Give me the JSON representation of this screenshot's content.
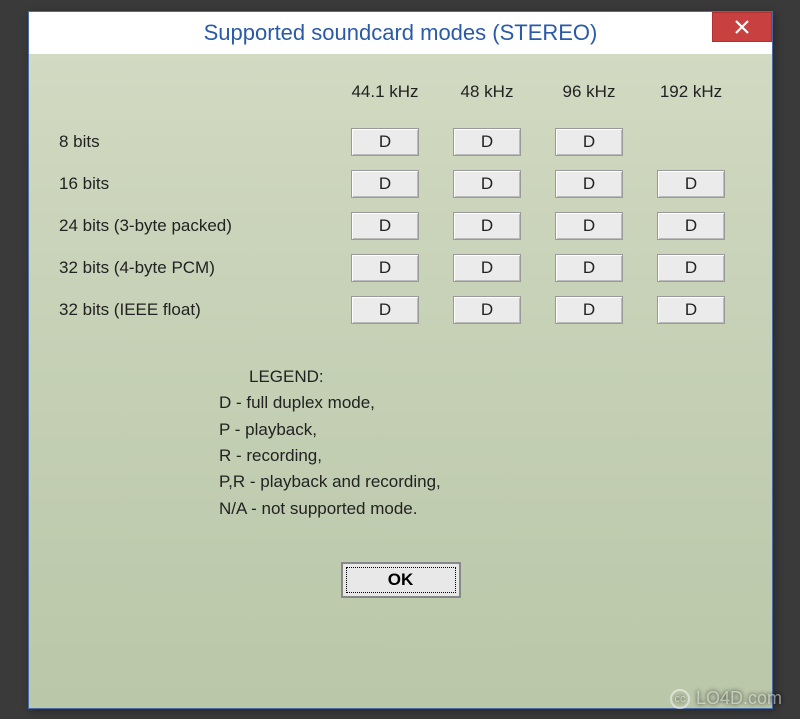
{
  "window": {
    "title": "Supported soundcard modes (STEREO)"
  },
  "columns": [
    "44.1 kHz",
    "48 kHz",
    "96 kHz",
    "192 kHz"
  ],
  "rows": [
    {
      "label": "8 bits",
      "cells": [
        "D",
        "D",
        "D",
        ""
      ]
    },
    {
      "label": "16 bits",
      "cells": [
        "D",
        "D",
        "D",
        "D"
      ]
    },
    {
      "label": "24 bits (3-byte packed)",
      "cells": [
        "D",
        "D",
        "D",
        "D"
      ]
    },
    {
      "label": "32 bits (4-byte PCM)",
      "cells": [
        "D",
        "D",
        "D",
        "D"
      ]
    },
    {
      "label": "32 bits (IEEE float)",
      "cells": [
        "D",
        "D",
        "D",
        "D"
      ]
    }
  ],
  "legend": {
    "title": "LEGEND:",
    "lines": [
      "D - full duplex mode,",
      "P - playback,",
      "R - recording,",
      "P,R - playback and recording,",
      "N/A - not supported mode."
    ]
  },
  "buttons": {
    "ok": "OK"
  },
  "watermark": "LO4D.com"
}
